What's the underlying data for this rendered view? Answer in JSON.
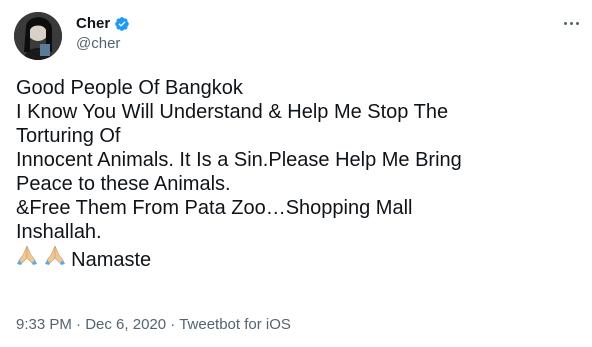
{
  "author": {
    "display_name": "Cher",
    "handle": "@cher",
    "verified_icon": "verified-badge-icon",
    "avatar_icon": "avatar"
  },
  "tweet": {
    "lines": [
      "Good People Of Bangkok",
      "I Know You Will Understand & Help Me Stop The",
      "Torturing Of",
      "Innocent Animals. It Is a Sin.Please Help Me Bring",
      "Peace to these Animals.",
      "&Free Them From Pata Zoo…Shopping Mall",
      "Inshallah."
    ],
    "closing_text": "Namaste",
    "closing_emoji": "folded-hands-icon"
  },
  "meta": {
    "time": "9:33 PM",
    "separator": "·",
    "date": "Dec 6, 2020",
    "source": "Tweetbot for iOS"
  },
  "colors": {
    "text": "#0f1419",
    "secondary": "#536471",
    "verified": "#1d9bf0",
    "emoji_skin": "#f0c896"
  }
}
